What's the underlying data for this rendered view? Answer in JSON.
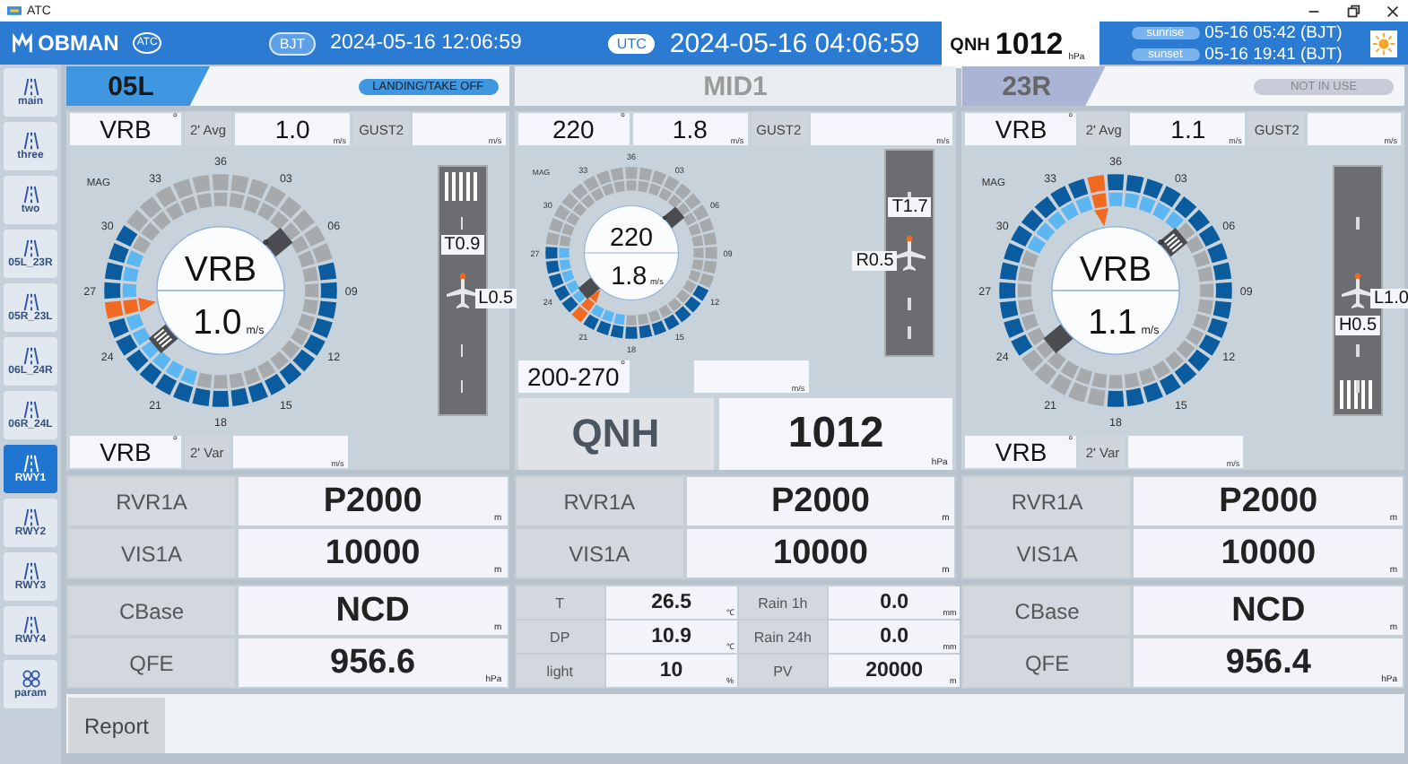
{
  "window": {
    "title": "ATC"
  },
  "header": {
    "logo": "OBMAN",
    "badge": "ATC",
    "local_zone": "BJT",
    "local_time": "2024-05-16 12:06:59",
    "utc_zone": "UTC",
    "utc_time": "2024-05-16 04:06:59",
    "qnh_label": "QNH",
    "qnh_value": "1012",
    "qnh_unit": "hPa",
    "sunrise_label": "sunrise",
    "sunrise": "05-16 05:42 (BJT)",
    "sunset_label": "sunset",
    "sunset": "05-16 19:41 (BJT)"
  },
  "sidebar": {
    "items": [
      {
        "label": "main",
        "kind": "runway",
        "selected": false
      },
      {
        "label": "three",
        "kind": "runway",
        "selected": false
      },
      {
        "label": "two",
        "kind": "runway",
        "selected": false
      },
      {
        "label": "05L_23R",
        "kind": "runway",
        "selected": false
      },
      {
        "label": "05R_23L",
        "kind": "runway",
        "selected": false
      },
      {
        "label": "06L_24R",
        "kind": "runway",
        "selected": false
      },
      {
        "label": "06R_24L",
        "kind": "runway",
        "selected": false
      },
      {
        "label": "RWY1",
        "kind": "runway",
        "selected": true
      },
      {
        "label": "RWY2",
        "kind": "runway",
        "selected": false
      },
      {
        "label": "RWY3",
        "kind": "runway",
        "selected": false
      },
      {
        "label": "RWY4",
        "kind": "runway",
        "selected": false
      },
      {
        "label": "param",
        "kind": "grid",
        "selected": false
      }
    ]
  },
  "panels": [
    {
      "name": "05L",
      "kind": "runway",
      "active": true,
      "status_label": "LANDING/TAKE OFF",
      "wind": {
        "dir": "VRB",
        "dir_unit": "°",
        "avg_label": "2' Avg",
        "speed": "1.0",
        "speed_unit": "m/s",
        "gust_label": "GUST2",
        "gust_unit": "m/s",
        "var_dir": "VRB",
        "var_dir_unit": "°",
        "var_label": "2' Var",
        "var_unit": "m/s",
        "mag": "MAG",
        "ticks": [
          "36",
          "03",
          "06",
          "09",
          "12",
          "15",
          "18",
          "21",
          "24",
          "27",
          "30",
          "33"
        ],
        "center_dir": "VRB",
        "center_dir_unit": "°",
        "center_speed": "1.0",
        "center_unit": "m/s",
        "outer": [
          {
            "color": "#a7aaad"
          },
          {
            "color": "#a7aaad"
          },
          {
            "color": "#a7aaad"
          },
          {
            "color": "#a7aaad"
          },
          {
            "color": "#a7aaad"
          },
          {
            "color": "#a7aaad"
          },
          {
            "color": "#a7aaad"
          },
          {
            "color": "#a7aaad"
          },
          {
            "color": "#0a5c9e"
          },
          {
            "color": "#0a5c9e"
          },
          {
            "color": "#0a5c9e"
          },
          {
            "color": "#0a5c9e"
          },
          {
            "color": "#0a5c9e"
          },
          {
            "color": "#0a5c9e"
          },
          {
            "color": "#0a5c9e"
          },
          {
            "color": "#0a5c9e"
          },
          {
            "color": "#0a5c9e"
          },
          {
            "color": "#0a5c9e"
          },
          {
            "color": "#0a5c9e"
          },
          {
            "color": "#0a5c9e"
          },
          {
            "color": "#0a5c9e"
          },
          {
            "color": "#0a5c9e"
          },
          {
            "color": "#0a5c9e"
          },
          {
            "color": "#0a5c9e"
          },
          {
            "color": "#0a5c9e"
          },
          {
            "color": "#0a5c9e"
          },
          {
            "color": "#f26a22"
          },
          {
            "color": "#0a5c9e"
          },
          {
            "color": "#0a5c9e"
          },
          {
            "color": "#0a5c9e"
          },
          {
            "color": "#0a5c9e"
          },
          {
            "color": "#a7aaad"
          },
          {
            "color": "#a7aaad"
          },
          {
            "color": "#a7aaad"
          },
          {
            "color": "#a7aaad"
          },
          {
            "color": "#a7aaad"
          }
        ],
        "inner": [
          {
            "color": "#a7aaad"
          },
          {
            "color": "#a7aaad"
          },
          {
            "color": "#a7aaad"
          },
          {
            "color": "#a7aaad"
          },
          {
            "color": "#a7aaad"
          },
          {
            "color": "#a7aaad"
          },
          {
            "color": "#a7aaad"
          },
          {
            "color": "#a7aaad"
          },
          {
            "color": "#a7aaad"
          },
          {
            "color": "#a7aaad"
          },
          {
            "color": "#a7aaad"
          },
          {
            "color": "#a7aaad"
          },
          {
            "color": "#a7aaad"
          },
          {
            "color": "#a7aaad"
          },
          {
            "color": "#a7aaad"
          },
          {
            "color": "#a7aaad"
          },
          {
            "color": "#a7aaad"
          },
          {
            "color": "#a7aaad"
          },
          {
            "color": "#a7aaad"
          },
          {
            "color": "#a7aaad"
          },
          {
            "color": "#5cb6f2"
          },
          {
            "color": "#5cb6f2"
          },
          {
            "color": "#5cb6f2"
          },
          {
            "color": "#5cb6f2"
          },
          {
            "color": "#5cb6f2"
          },
          {
            "color": "#5cb6f2"
          },
          {
            "color": "#f26a22"
          },
          {
            "color": "#5cb6f2"
          },
          {
            "color": "#5cb6f2"
          },
          {
            "color": "#5cb6f2"
          },
          {
            "color": "#a7aaad"
          },
          {
            "color": "#a7aaad"
          },
          {
            "color": "#a7aaad"
          },
          {
            "color": "#a7aaad"
          },
          {
            "color": "#a7aaad"
          },
          {
            "color": "#a7aaad"
          }
        ],
        "pointer": {
          "color": "#f26a22"
        },
        "strip": {
          "threshold_top": true,
          "threshold_bottom": false,
          "labels": [
            {
              "text": "T0.9",
              "kind": "top"
            },
            {
              "text": "L0.5",
              "kind": "right"
            }
          ]
        }
      },
      "rvr": [
        {
          "label": "RVR1A",
          "value": "P2000",
          "unit": "m"
        },
        {
          "label": "VIS1A",
          "value": "10000",
          "unit": "m"
        }
      ],
      "met": [
        {
          "label": "CBase",
          "value": "NCD",
          "unit": "m"
        },
        {
          "label": "QFE",
          "value": "956.6",
          "unit": "hPa"
        }
      ]
    },
    {
      "name": "MID1",
      "kind": "mid",
      "wind": {
        "dir": "220",
        "dir_unit": "°",
        "speed": "1.8",
        "speed_unit": "m/s",
        "gust_label": "GUST2",
        "gust_unit": "m/s",
        "var_dir": "200-270",
        "var_dir_unit": "°",
        "var_unit": "m/s",
        "mag": "MAG",
        "ticks": [
          "36",
          "03",
          "06",
          "09",
          "12",
          "15",
          "18",
          "21",
          "24",
          "27",
          "30",
          "33"
        ],
        "center_dir": "220",
        "center_dir_unit": "°",
        "center_speed": "1.8",
        "center_unit": "m/s",
        "outer": [
          {
            "color": "#a7aaad"
          },
          {
            "color": "#a7aaad"
          },
          {
            "color": "#a7aaad"
          },
          {
            "color": "#a7aaad"
          },
          {
            "color": "#a7aaad"
          },
          {
            "color": "#a7aaad"
          },
          {
            "color": "#a7aaad"
          },
          {
            "color": "#a7aaad"
          },
          {
            "color": "#a7aaad"
          },
          {
            "color": "#a7aaad"
          },
          {
            "color": "#a7aaad"
          },
          {
            "color": "#a7aaad"
          },
          {
            "color": "#0a5c9e"
          },
          {
            "color": "#0a5c9e"
          },
          {
            "color": "#0a5c9e"
          },
          {
            "color": "#0a5c9e"
          },
          {
            "color": "#0a5c9e"
          },
          {
            "color": "#0a5c9e"
          },
          {
            "color": "#0a5c9e"
          },
          {
            "color": "#0a5c9e"
          },
          {
            "color": "#0a5c9e"
          },
          {
            "color": "#0a5c9e"
          },
          {
            "color": "#f26a22"
          },
          {
            "color": "#0a5c9e"
          },
          {
            "color": "#0a5c9e"
          },
          {
            "color": "#0a5c9e"
          },
          {
            "color": "#0a5c9e"
          },
          {
            "color": "#0a5c9e"
          },
          {
            "color": "#a7aaad"
          },
          {
            "color": "#a7aaad"
          },
          {
            "color": "#a7aaad"
          },
          {
            "color": "#a7aaad"
          },
          {
            "color": "#a7aaad"
          },
          {
            "color": "#a7aaad"
          },
          {
            "color": "#a7aaad"
          },
          {
            "color": "#a7aaad"
          }
        ],
        "inner": [
          {
            "color": "#a7aaad"
          },
          {
            "color": "#a7aaad"
          },
          {
            "color": "#a7aaad"
          },
          {
            "color": "#a7aaad"
          },
          {
            "color": "#a7aaad"
          },
          {
            "color": "#a7aaad"
          },
          {
            "color": "#a7aaad"
          },
          {
            "color": "#a7aaad"
          },
          {
            "color": "#a7aaad"
          },
          {
            "color": "#a7aaad"
          },
          {
            "color": "#a7aaad"
          },
          {
            "color": "#a7aaad"
          },
          {
            "color": "#a7aaad"
          },
          {
            "color": "#a7aaad"
          },
          {
            "color": "#a7aaad"
          },
          {
            "color": "#a7aaad"
          },
          {
            "color": "#a7aaad"
          },
          {
            "color": "#a7aaad"
          },
          {
            "color": "#a7aaad"
          },
          {
            "color": "#5cb6f2"
          },
          {
            "color": "#5cb6f2"
          },
          {
            "color": "#5cb6f2"
          },
          {
            "color": "#f26a22"
          },
          {
            "color": "#5cb6f2"
          },
          {
            "color": "#5cb6f2"
          },
          {
            "color": "#5cb6f2"
          },
          {
            "color": "#5cb6f2"
          },
          {
            "color": "#5cb6f2"
          },
          {
            "color": "#a7aaad"
          },
          {
            "color": "#a7aaad"
          },
          {
            "color": "#a7aaad"
          },
          {
            "color": "#a7aaad"
          },
          {
            "color": "#a7aaad"
          },
          {
            "color": "#a7aaad"
          },
          {
            "color": "#a7aaad"
          },
          {
            "color": "#a7aaad"
          }
        ],
        "pointer": {
          "color": "#f26a22"
        },
        "strip": {
          "threshold_top": false,
          "threshold_bottom": false,
          "labels": [
            {
              "text": "T1.7",
              "kind": "top"
            },
            {
              "text": "R0.5",
              "kind": "left"
            }
          ]
        }
      },
      "qnh": {
        "label": "QNH",
        "value": "1012",
        "unit": "hPa"
      },
      "rvr": [
        {
          "label": "RVR1A",
          "value": "P2000",
          "unit": "m"
        },
        {
          "label": "VIS1A",
          "value": "10000",
          "unit": "m"
        }
      ],
      "met": [
        {
          "label": "T",
          "value": "26.5",
          "unit": "℃"
        },
        {
          "label": "Rain 1h",
          "value": "0.0",
          "unit": "mm"
        },
        {
          "label": "DP",
          "value": "10.9",
          "unit": "℃"
        },
        {
          "label": "Rain 24h",
          "value": "0.0",
          "unit": "mm"
        },
        {
          "label": "light",
          "value": "10",
          "unit": "%"
        },
        {
          "label": "PV",
          "value": "20000",
          "unit": "m"
        }
      ]
    },
    {
      "name": "23R",
      "kind": "runway",
      "active": false,
      "status_label": "NOT IN USE",
      "wind": {
        "dir": "VRB",
        "dir_unit": "°",
        "avg_label": "2' Avg",
        "speed": "1.1",
        "speed_unit": "m/s",
        "gust_label": "GUST2",
        "gust_unit": "m/s",
        "var_dir": "VRB",
        "var_dir_unit": "°",
        "var_label": "2' Var",
        "var_unit": "m/s",
        "mag": "MAG",
        "ticks": [
          "36",
          "03",
          "06",
          "09",
          "12",
          "15",
          "18",
          "21",
          "24",
          "27",
          "30",
          "33"
        ],
        "center_dir": "VRB",
        "center_dir_unit": "°",
        "center_speed": "1.1",
        "center_unit": "m/s",
        "outer": [
          {
            "color": "#0a5c9e"
          },
          {
            "color": "#0a5c9e"
          },
          {
            "color": "#0a5c9e"
          },
          {
            "color": "#0a5c9e"
          },
          {
            "color": "#0a5c9e"
          },
          {
            "color": "#0a5c9e"
          },
          {
            "color": "#0a5c9e"
          },
          {
            "color": "#0a5c9e"
          },
          {
            "color": "#0a5c9e"
          },
          {
            "color": "#0a5c9e"
          },
          {
            "color": "#0a5c9e"
          },
          {
            "color": "#0a5c9e"
          },
          {
            "color": "#0a5c9e"
          },
          {
            "color": "#0a5c9e"
          },
          {
            "color": "#0a5c9e"
          },
          {
            "color": "#0a5c9e"
          },
          {
            "color": "#0a5c9e"
          },
          {
            "color": "#0a5c9e"
          },
          {
            "color": "#0a5c9e"
          },
          {
            "color": "#a7aaad"
          },
          {
            "color": "#a7aaad"
          },
          {
            "color": "#a7aaad"
          },
          {
            "color": "#a7aaad"
          },
          {
            "color": "#a7aaad"
          },
          {
            "color": "#0a5c9e"
          },
          {
            "color": "#0a5c9e"
          },
          {
            "color": "#0a5c9e"
          },
          {
            "color": "#0a5c9e"
          },
          {
            "color": "#0a5c9e"
          },
          {
            "color": "#0a5c9e"
          },
          {
            "color": "#0a5c9e"
          },
          {
            "color": "#0a5c9e"
          },
          {
            "color": "#0a5c9e"
          },
          {
            "color": "#0a5c9e"
          },
          {
            "color": "#0a5c9e"
          },
          {
            "color": "#f26a22"
          }
        ],
        "inner": [
          {
            "color": "#5cb6f2"
          },
          {
            "color": "#5cb6f2"
          },
          {
            "color": "#5cb6f2"
          },
          {
            "color": "#5cb6f2"
          },
          {
            "color": "#5cb6f2"
          },
          {
            "color": "#a7aaad"
          },
          {
            "color": "#a7aaad"
          },
          {
            "color": "#a7aaad"
          },
          {
            "color": "#a7aaad"
          },
          {
            "color": "#a7aaad"
          },
          {
            "color": "#a7aaad"
          },
          {
            "color": "#a7aaad"
          },
          {
            "color": "#a7aaad"
          },
          {
            "color": "#a7aaad"
          },
          {
            "color": "#a7aaad"
          },
          {
            "color": "#a7aaad"
          },
          {
            "color": "#a7aaad"
          },
          {
            "color": "#a7aaad"
          },
          {
            "color": "#a7aaad"
          },
          {
            "color": "#a7aaad"
          },
          {
            "color": "#a7aaad"
          },
          {
            "color": "#a7aaad"
          },
          {
            "color": "#a7aaad"
          },
          {
            "color": "#a7aaad"
          },
          {
            "color": "#a7aaad"
          },
          {
            "color": "#a7aaad"
          },
          {
            "color": "#a7aaad"
          },
          {
            "color": "#a7aaad"
          },
          {
            "color": "#a7aaad"
          },
          {
            "color": "#a7aaad"
          },
          {
            "color": "#5cb6f2"
          },
          {
            "color": "#5cb6f2"
          },
          {
            "color": "#5cb6f2"
          },
          {
            "color": "#5cb6f2"
          },
          {
            "color": "#5cb6f2"
          },
          {
            "color": "#f26a22"
          }
        ],
        "pointer": {
          "color": "#f26a22"
        },
        "strip": {
          "threshold_top": false,
          "threshold_bottom": true,
          "labels": [
            {
              "text": "L1.0",
              "kind": "right"
            },
            {
              "text": "H0.5",
              "kind": "bottom"
            }
          ]
        }
      },
      "rvr": [
        {
          "label": "RVR1A",
          "value": "P2000",
          "unit": "m"
        },
        {
          "label": "VIS1A",
          "value": "10000",
          "unit": "m"
        }
      ],
      "met": [
        {
          "label": "CBase",
          "value": "NCD",
          "unit": "m"
        },
        {
          "label": "QFE",
          "value": "956.4",
          "unit": "hPa"
        }
      ]
    }
  ],
  "report_button": "Report"
}
